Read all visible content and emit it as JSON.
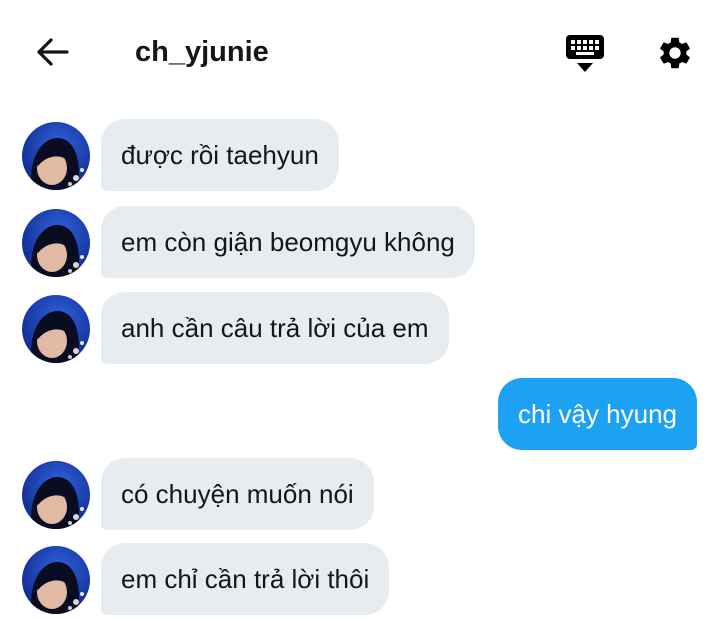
{
  "header": {
    "title": "ch_yjunie",
    "back_icon": "arrow-left-icon",
    "keyboard_icon": "keyboard-hide-icon",
    "settings_icon": "gear-icon"
  },
  "messages": [
    {
      "from": "them",
      "text": "được rồi taehyun"
    },
    {
      "from": "them",
      "text": "em còn giận beomgyu không"
    },
    {
      "from": "them",
      "text": "anh cần câu trả lời của em"
    },
    {
      "from": "me",
      "text": "chi vậy hyung"
    },
    {
      "from": "them",
      "text": "có chuyện muốn nói"
    },
    {
      "from": "them",
      "text": "em chỉ cần trả lời thôi"
    }
  ],
  "colors": {
    "incoming_bubble": "#e6ecf0",
    "outgoing_bubble": "#1da1f2",
    "text": "#14171a",
    "outgoing_text": "#ffffff"
  }
}
